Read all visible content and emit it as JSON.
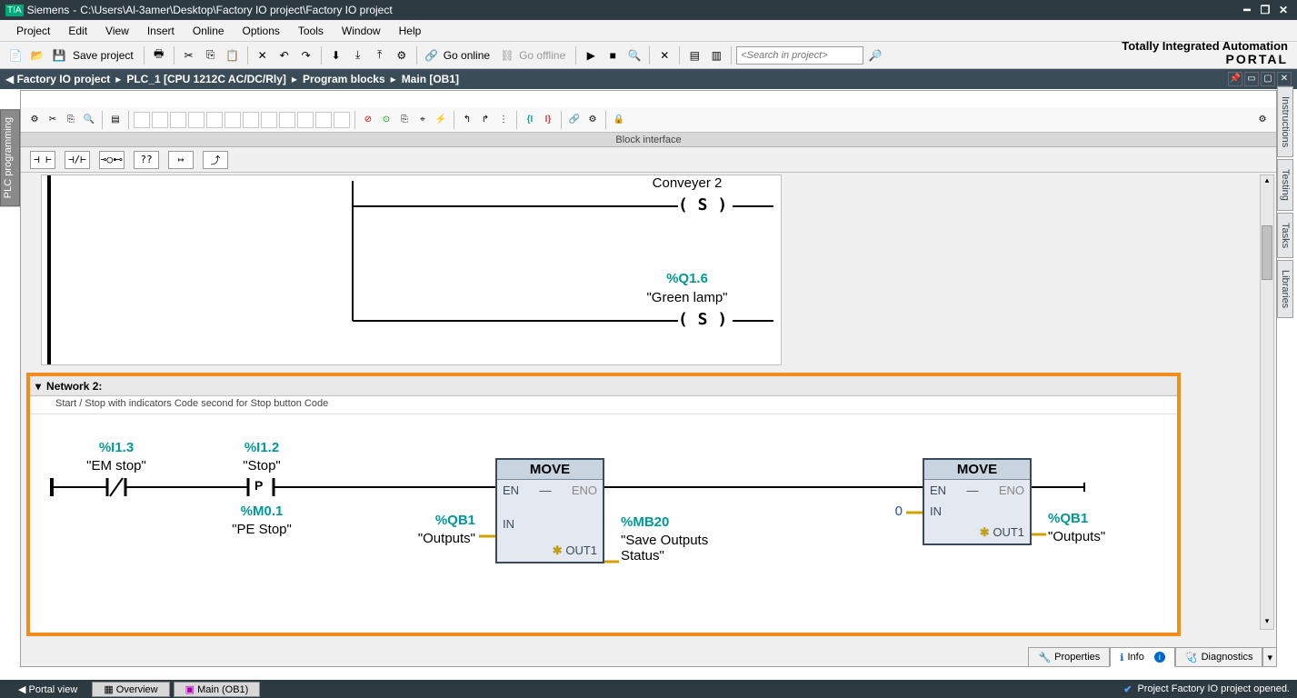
{
  "title_bar": {
    "app": "Siemens",
    "path": "C:\\Users\\Al-3amer\\Desktop\\Factory IO project\\Factory IO project"
  },
  "menu": [
    "Project",
    "Edit",
    "View",
    "Insert",
    "Online",
    "Options",
    "Tools",
    "Window",
    "Help"
  ],
  "toolbar": {
    "save_label": "Save project",
    "go_online": "Go online",
    "go_offline": "Go offline",
    "search_placeholder": "<Search in project>"
  },
  "brand": {
    "line1": "Totally Integrated Automation",
    "line2": "PORTAL"
  },
  "breadcrumb": [
    "Factory IO project",
    "PLC_1 [CPU 1212C AC/DC/Rly]",
    "Program blocks",
    "Main [OB1]"
  ],
  "side_left": "PLC programming",
  "side_right": [
    "Instructions",
    "Testing",
    "Tasks",
    "Libraries"
  ],
  "block_interface": "Block interface",
  "lad_buttons": [
    "⊣ ⊢",
    "⊣/⊢",
    "⊸○⊷",
    "??",
    "↦",
    "⤴"
  ],
  "net1": {
    "conveyor_label": "Conveyer 2",
    "coil1": "( S )",
    "out2_addr": "%Q1.6",
    "out2_tag": "\"Green lamp\"",
    "coil2": "( S )"
  },
  "net2": {
    "title": "Network 2:",
    "desc": "Start / Stop with indicators Code second for Stop button Code",
    "in1_addr": "%I1.3",
    "in1_tag": "\"EM stop\"",
    "in2_addr": "%I1.2",
    "in2_tag": "\"Stop\"",
    "mem_addr": "%M0.1",
    "mem_tag": "\"PE Stop\"",
    "move1_head": "MOVE",
    "move1_en": "EN",
    "move1_eno": "ENO",
    "move1_in": "IN",
    "move1_out": "OUT1",
    "move1_in_addr": "%QB1",
    "move1_in_tag": "\"Outputs\"",
    "move1_out_addr": "%MB20",
    "move1_out_tag": "\"Save Outputs Status\"",
    "move2_head": "MOVE",
    "move2_en": "EN",
    "move2_eno": "ENO",
    "move2_in": "IN",
    "move2_out": "OUT1",
    "move2_in_val": "0",
    "move2_out_addr": "%QB1",
    "move2_out_tag": "\"Outputs\""
  },
  "zoom": "150%",
  "prop_tabs": {
    "properties": "Properties",
    "info": "Info",
    "diagnostics": "Diagnostics"
  },
  "bottom": {
    "portal": "◀  Portal view",
    "overview": "Overview",
    "main": "Main (OB1)",
    "status": "Project Factory IO project opened."
  }
}
